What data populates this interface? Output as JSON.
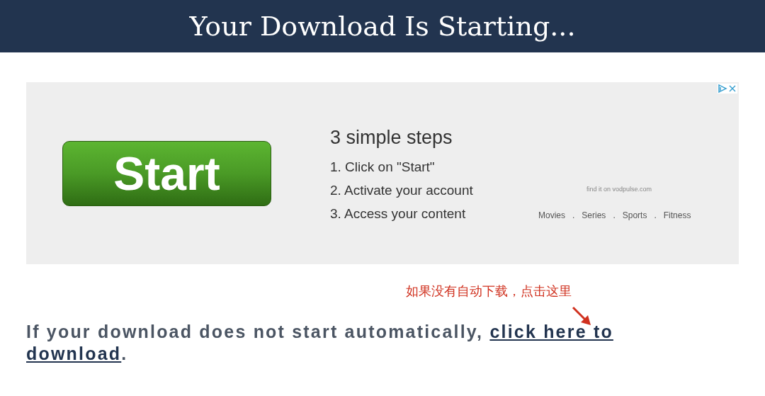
{
  "header": {
    "title": "Your Download Is Starting..."
  },
  "ad": {
    "button": "Start",
    "steps_title": "3 simple steps",
    "steps": [
      "1. Click on \"Start\"",
      "2. Activate your account",
      "3. Access your content"
    ],
    "tagline": "find it on vodpulse.com",
    "categories": [
      "Movies",
      ".",
      "Series",
      ".",
      "Sports",
      ".",
      "Fitness"
    ]
  },
  "annotation": {
    "text": "如果没有自动下载，点击这里"
  },
  "message": {
    "text": "If your download does not start automatically, ",
    "link_parts": [
      "click here to",
      "download"
    ],
    "end": "."
  }
}
